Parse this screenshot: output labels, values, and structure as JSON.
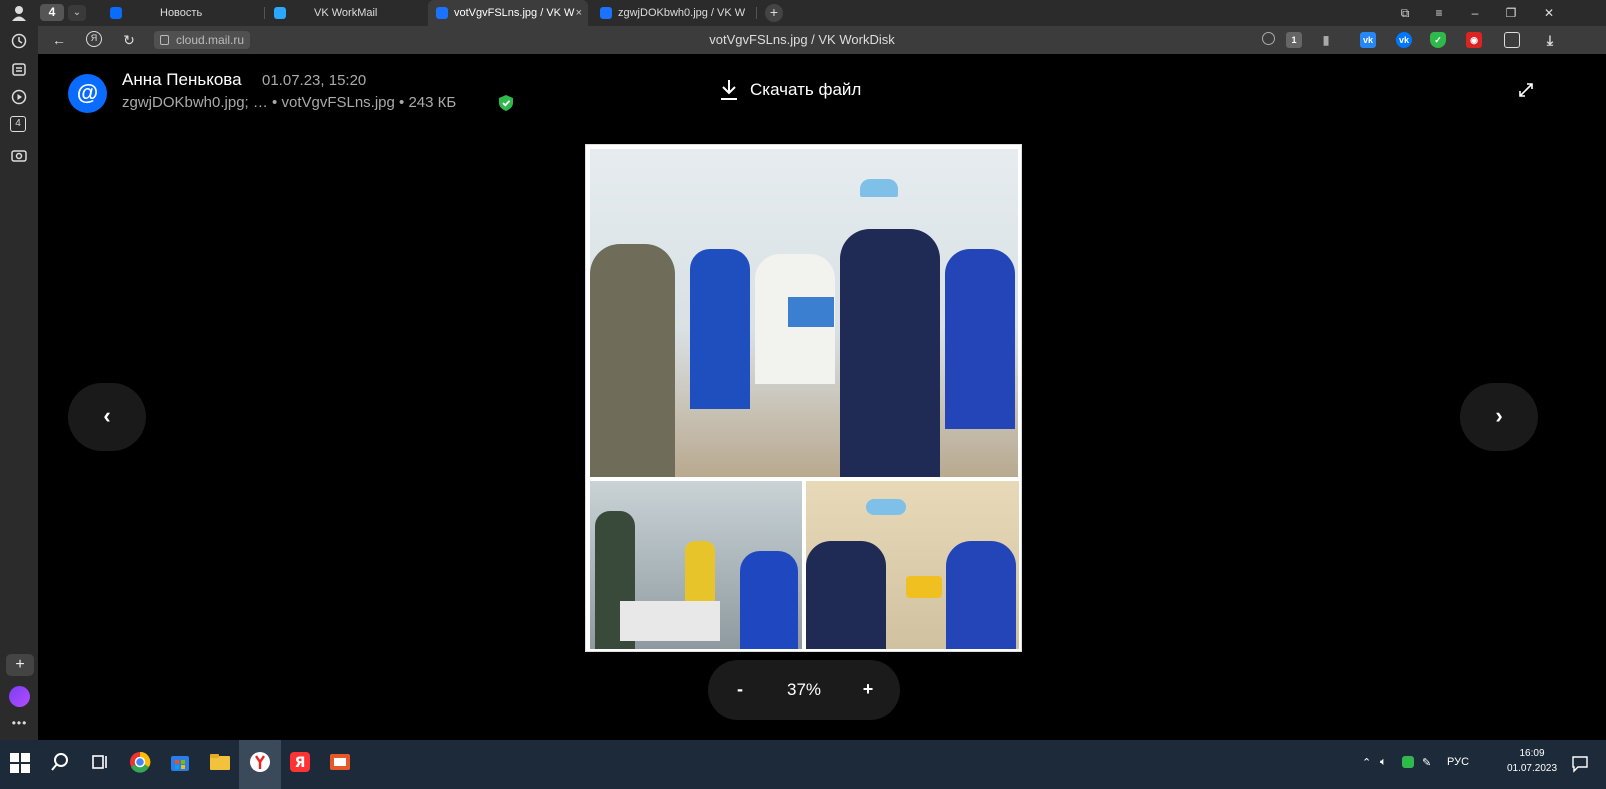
{
  "tabbar": {
    "counter": "4",
    "tabs": [
      {
        "label": "Новость",
        "active": false,
        "favicon_color": "#0a6bff"
      },
      {
        "label": "VK WorkMail",
        "active": false,
        "favicon_color": "#2aa7ff"
      },
      {
        "label": "votVgvFSLns.jpg / VK W",
        "active": true,
        "favicon_color": "#1a73ff"
      },
      {
        "label": "zgwjDOKbwh0.jpg / VK W",
        "active": false,
        "favicon_color": "#1a73ff"
      }
    ],
    "new_tab_label": "+",
    "close_label": "×"
  },
  "sidebar": {
    "history_icon": "clock-icon",
    "collections_icon": "collections-icon",
    "video_icon": "play-icon",
    "counter": "4",
    "camera_icon": "camera-icon",
    "add_label": "+",
    "more_label": "•••"
  },
  "addrbar": {
    "back_icon": "←",
    "yandex_icon": "Я",
    "reload_icon": "↻",
    "url": "cloud.mail.ru",
    "title": "votVgvFSLns.jpg / VK WorkDisk"
  },
  "viewer": {
    "sender_name": "Анна Пенькова",
    "date": "01.07.23, 15:20",
    "files_line": "zgwjDOKbwh0.jpg; …  • votVgvFSLns.jpg • 243 КБ",
    "download_label": "Скачать файл",
    "prev_icon": "‹",
    "next_icon": "›",
    "zoom_minus": "-",
    "zoom_value": "37%",
    "zoom_plus": "+"
  },
  "taskbar": {
    "lang": "РУС",
    "time": "16:09",
    "date": "01.07.2023"
  },
  "colors": {
    "accent": "#0a6bff",
    "shield_green": "#2fb84b",
    "background": "#000000"
  }
}
